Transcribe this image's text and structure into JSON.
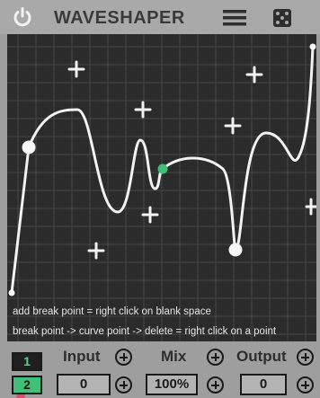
{
  "header": {
    "title": "WAVESHAPER",
    "power_icon": "power-icon",
    "menu_icon": "hamburger-menu-icon",
    "random_icon": "dice-icon"
  },
  "graph": {
    "help_line_1": "add break point = right click on blank space",
    "help_line_2": "break point -> curve point -> delete = right click on a point",
    "curve_color": "#f2f2f2",
    "grid_color": "#4a4a4a",
    "background_color": "#2b2b2b",
    "curve_point_color": "#3fbf78"
  },
  "bottom": {
    "tabs": [
      "1",
      "2"
    ],
    "selected_tab": "2",
    "input": {
      "label": "Input",
      "value": "0"
    },
    "mix": {
      "label": "Mix",
      "value": "100%"
    },
    "output": {
      "label": "Output",
      "value": "0"
    }
  }
}
